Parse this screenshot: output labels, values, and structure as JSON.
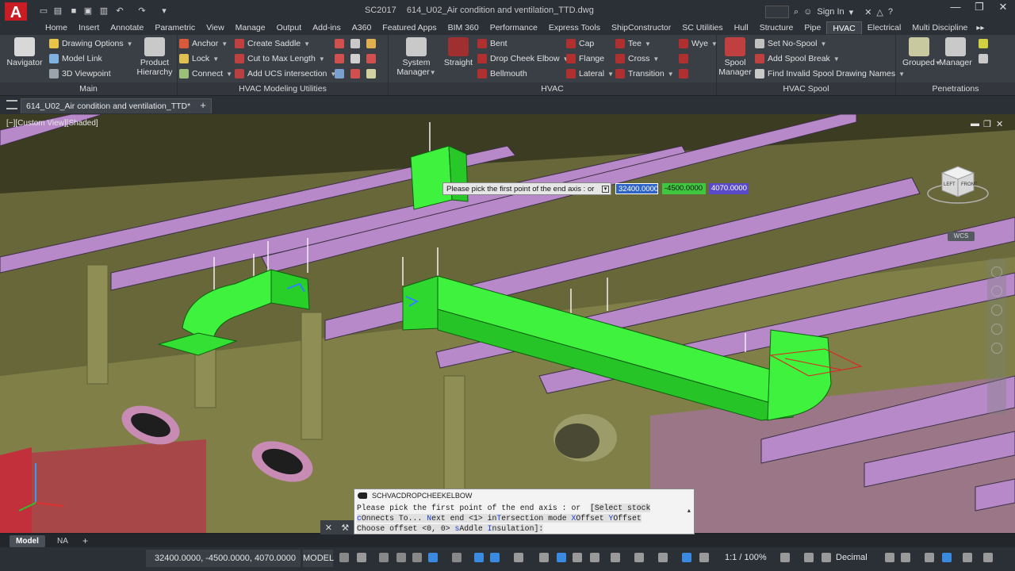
{
  "app": {
    "logo_letter": "A",
    "title_left": "SC2017",
    "title_file": "614_U02_Air condition and ventilation_TTD.dwg",
    "sign_in": "Sign In",
    "help_glyph": "?"
  },
  "ribbon_tabs": [
    "Home",
    "Insert",
    "Annotate",
    "Parametric",
    "View",
    "Manage",
    "Output",
    "Add-ins",
    "A360",
    "Featured Apps",
    "BIM 360",
    "Performance",
    "Express Tools",
    "ShipConstructor",
    "SC Utilities",
    "Hull",
    "Structure",
    "Pipe",
    "HVAC",
    "Electrical",
    "Multi Discipline"
  ],
  "active_tab": "HVAC",
  "panels": {
    "main": {
      "title": "Main",
      "navigator": "Navigator",
      "drawing_options": "Drawing Options",
      "model_link": "Model Link",
      "viewpoint": "3D Viewpoint"
    },
    "modeling": {
      "title": "HVAC Modeling Utilities",
      "product_hierarchy_1": "Product",
      "product_hierarchy_2": "Hierarchy",
      "anchor": "Anchor",
      "lock": "Lock",
      "connect": "Connect",
      "create_saddle": "Create Saddle",
      "cut_to_max": "Cut to Max Length",
      "add_ucs": "Add UCS intersection"
    },
    "hvac": {
      "title": "HVAC",
      "system_manager_1": "System",
      "system_manager_2": "Manager",
      "straight": "Straight",
      "bent": "Bent",
      "drop_cheek_elbow": "Drop Cheek Elbow",
      "bellmouth": "Bellmouth",
      "cap": "Cap",
      "flange": "Flange",
      "lateral": "Lateral",
      "tee": "Tee",
      "cross": "Cross",
      "transition": "Transition",
      "wye": "Wye"
    },
    "spool": {
      "title": "HVAC Spool",
      "spool_manager_1": "Spool",
      "spool_manager_2": "Manager",
      "set_no_spool": "Set No-Spool",
      "add_spool_break": "Add Spool Break",
      "find_invalid": "Find Invalid Spool Drawing Names"
    },
    "penetrations": {
      "title": "Penetrations",
      "grouped": "Grouped",
      "manager": "Manager"
    }
  },
  "document_tab": "614_U02_Air condition and ventilation_TTD*",
  "viewport": {
    "label": "[−][Custom View][Shaded]",
    "viewcube_left": "LEFT",
    "viewcube_front": "FRONT",
    "wcs": "WCS"
  },
  "dynamic_input": {
    "prompt": "Please pick the first point of the end axis : or",
    "x": "32400.0000",
    "y": "-4500.0000",
    "z": "4070.0000"
  },
  "command": {
    "name": "SCHVACDROPCHEEKELBOW",
    "line1_a": "Please pick the first point of the end axis : or  ",
    "line1_b": "[Select stock",
    "line2_c": "c",
    "line2_c_rest": "Onnects To... ",
    "line2_n": "N",
    "line2_n_rest": "ext end <1> in",
    "line2_t": "T",
    "line2_t_rest": "ersection mode ",
    "line2_x": "X",
    "line2_x_rest": "Offset ",
    "line2_y": "Y",
    "line2_y_rest": "Offset",
    "line3_a": "Choose offset <0, 0> ",
    "line3_s": "s",
    "line3_rest": "Addle ",
    "line3_i": "I",
    "line3_end": "nsulation]:"
  },
  "layout_tabs": {
    "model": "Model",
    "na": "NA",
    "add": "+"
  },
  "status": {
    "coords": "32400.0000, -4500.0000, 4070.0000",
    "space": "MODEL",
    "scale": "1:1 / 100%",
    "units": "Decimal"
  },
  "colors": {
    "duct_green": "#3ef23e",
    "beam_purple": "#b07fc0",
    "deck_olive": "#7f7f45",
    "active_tab_bg": "#3d434b"
  }
}
